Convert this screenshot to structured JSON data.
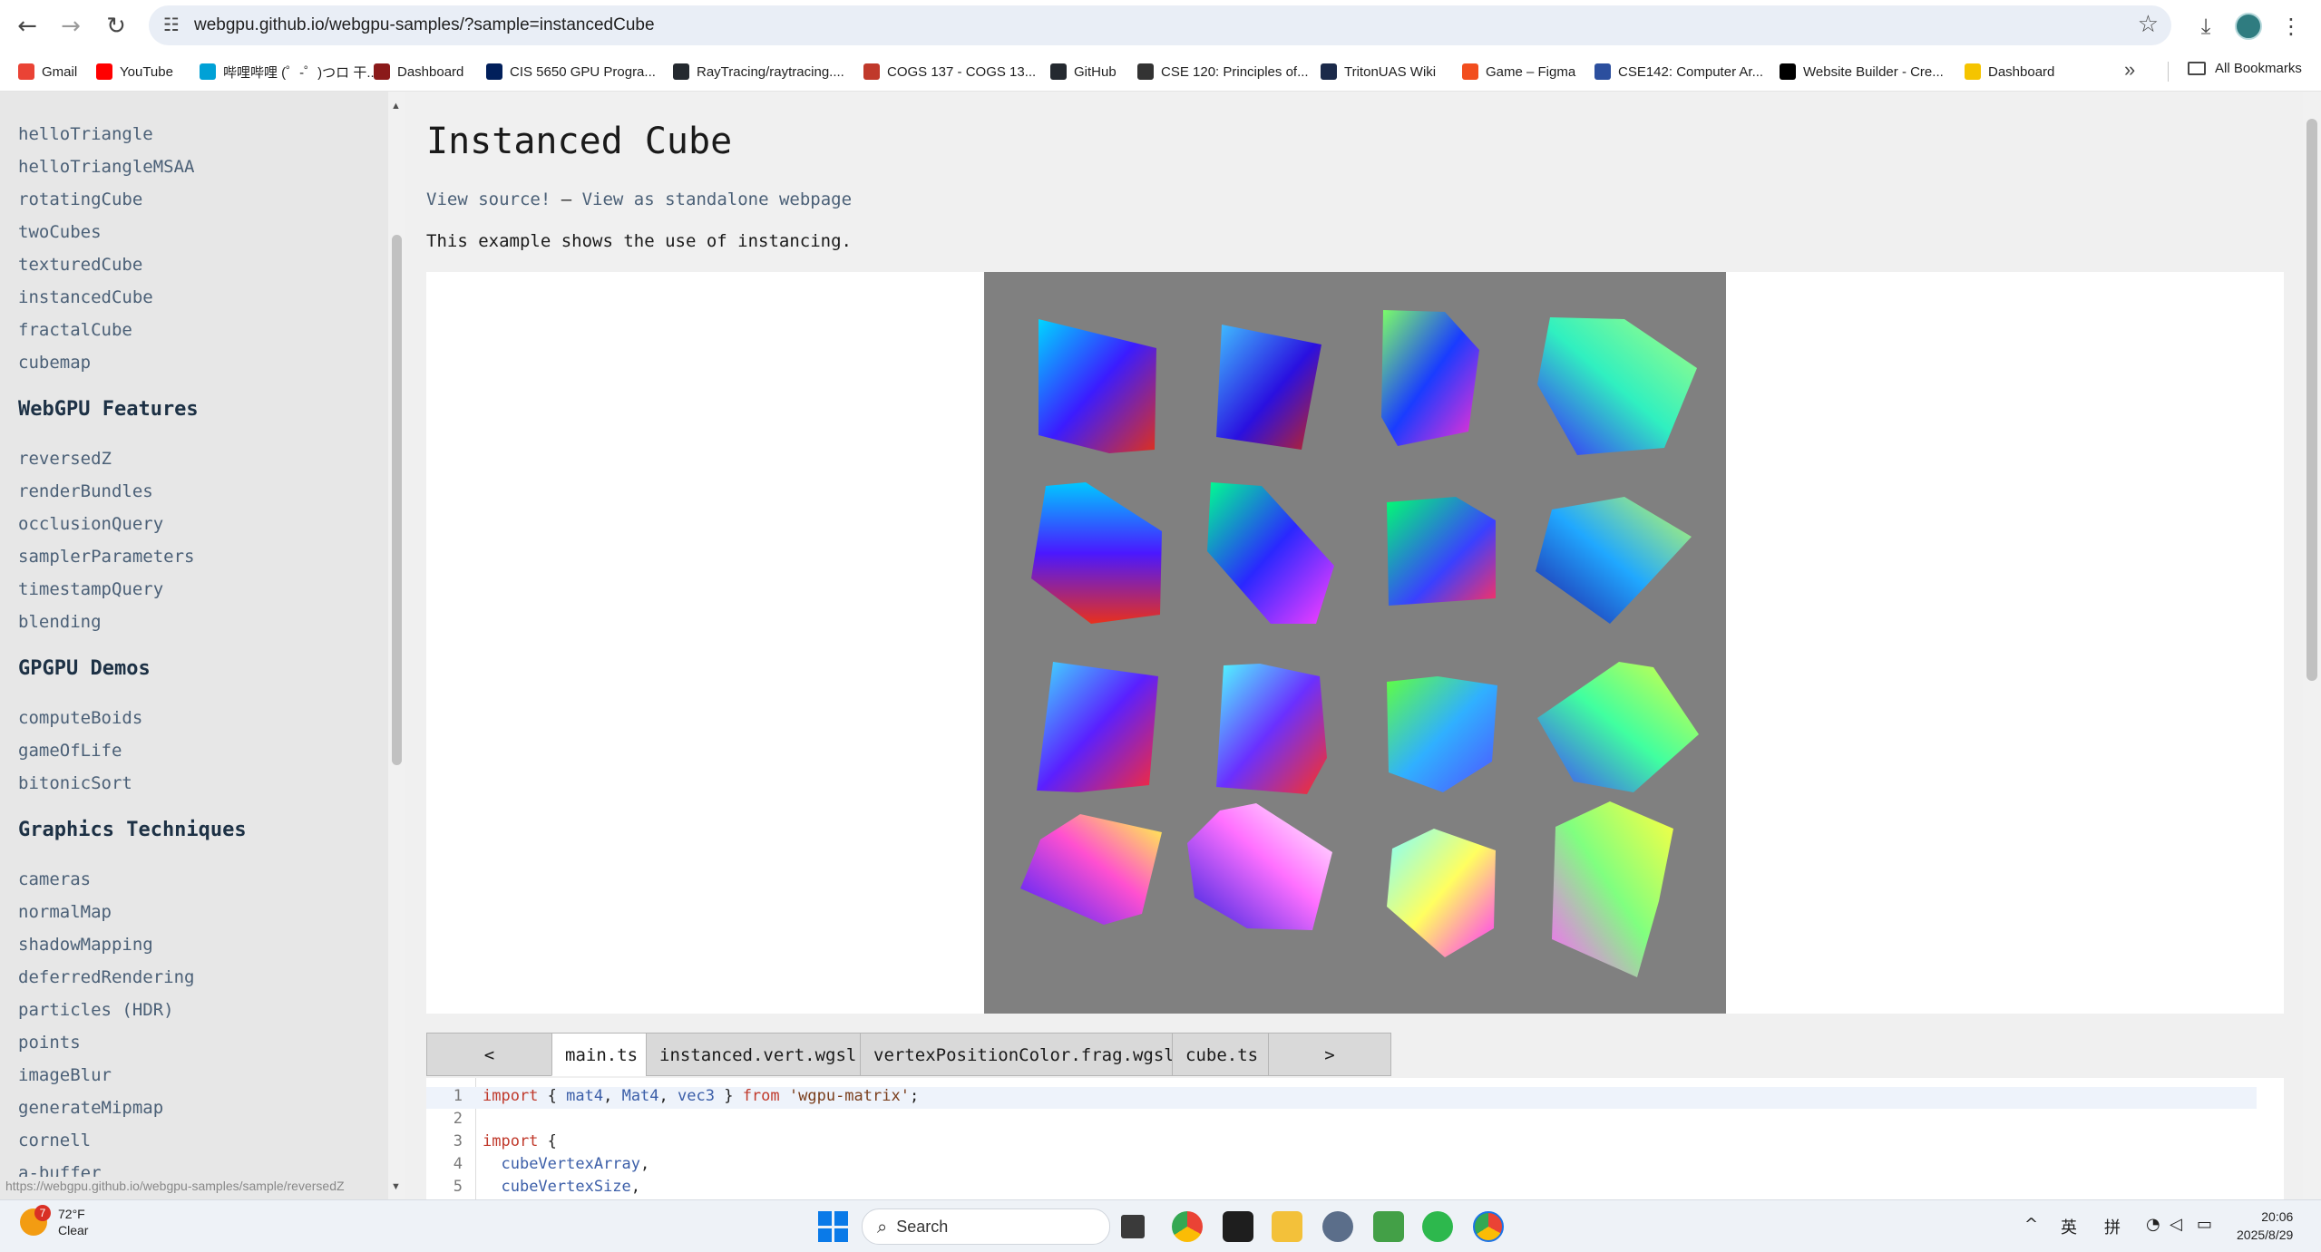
{
  "browser": {
    "url": "webgpu.github.io/webgpu-samples/?sample=instancedCube",
    "bookmarks": [
      {
        "label": "Gmail",
        "color": "#ea4335"
      },
      {
        "label": "YouTube",
        "color": "#ff0000"
      },
      {
        "label": "哔哩哔哩 (゜-゜)つロ 干...",
        "color": "#00a1d6"
      },
      {
        "label": "Dashboard",
        "color": "#8b1a1a"
      },
      {
        "label": "CIS 5650 GPU Progra...",
        "color": "#011f5b"
      },
      {
        "label": "RayTracing/raytracing....",
        "color": "#24292f"
      },
      {
        "label": "COGS 137 - COGS 13...",
        "color": "#c0392b"
      },
      {
        "label": "GitHub",
        "color": "#24292f"
      },
      {
        "label": "CSE 120: Principles of...",
        "color": "#333333"
      },
      {
        "label": "TritonUAS Wiki",
        "color": "#1b2a4a"
      },
      {
        "label": "Game – Figma",
        "color": "#f24e1e"
      },
      {
        "label": "CSE142: Computer Ar...",
        "color": "#2c4f9e"
      },
      {
        "label": "Website Builder - Cre...",
        "color": "#000000"
      },
      {
        "label": "Dashboard",
        "color": "#f5c400"
      }
    ],
    "all_bookmarks": "All Bookmarks",
    "status_url": "https://webgpu.github.io/webgpu-samples/sample/reversedZ"
  },
  "sidebar": {
    "top_items": [
      "helloTriangle",
      "helloTriangleMSAA",
      "rotatingCube",
      "twoCubes",
      "texturedCube",
      "instancedCube",
      "fractalCube",
      "cubemap"
    ],
    "sections": [
      {
        "title": "WebGPU Features",
        "items": [
          "reversedZ",
          "renderBundles",
          "occlusionQuery",
          "samplerParameters",
          "timestampQuery",
          "blending"
        ]
      },
      {
        "title": "GPGPU Demos",
        "items": [
          "computeBoids",
          "gameOfLife",
          "bitonicSort"
        ]
      },
      {
        "title": "Graphics Techniques",
        "items": [
          "cameras",
          "normalMap",
          "shadowMapping",
          "deferredRendering",
          "particles (HDR)",
          "points",
          "imageBlur",
          "generateMipmap",
          "cornell",
          "a-buffer"
        ]
      }
    ]
  },
  "main": {
    "title": "Instanced Cube",
    "view_source": "View source!",
    "separator": " — ",
    "view_standalone": "View as standalone webpage",
    "description": "This example shows the use of instancing.",
    "tabs": [
      "<",
      "main.ts",
      "instanced.vert.wgsl",
      "vertexPositionColor.frag.wgsl",
      "cube.ts",
      ">"
    ],
    "active_tab": "main.ts",
    "code_lines": [
      {
        "n": "1",
        "html": "import { mat4, Mat4, vec3 } from 'wgpu-matrix';"
      },
      {
        "n": "2",
        "html": ""
      },
      {
        "n": "3",
        "html": "import {"
      },
      {
        "n": "4",
        "html": "  cubeVertexArray,"
      },
      {
        "n": "5",
        "html": "  cubeVertexSize,"
      }
    ]
  },
  "taskbar": {
    "temperature": "72°F",
    "condition": "Clear",
    "weather_badge": "7",
    "search": "Search",
    "ime1": "英",
    "ime2": "拼",
    "time": "20:06",
    "date": "2025/8/29"
  }
}
